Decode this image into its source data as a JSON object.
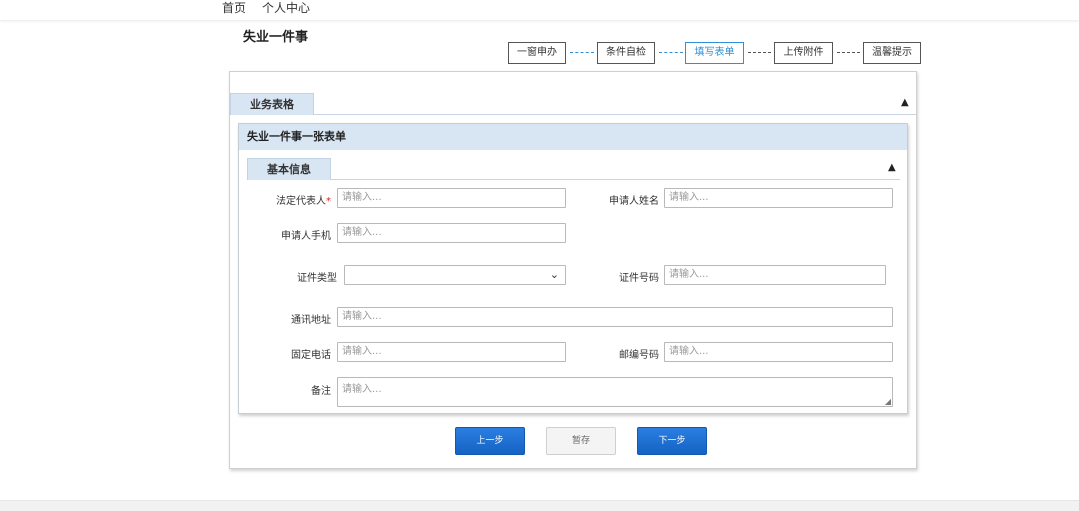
{
  "nav": {
    "home": "首页",
    "personal": "个人中心"
  },
  "page_title": "失业一件事",
  "steps": [
    "一窗申办",
    "条件自检",
    "填写表单",
    "上传附件",
    "温馨提示"
  ],
  "active_step": "填写表单",
  "outer_panel": {
    "tab": "业务表格"
  },
  "form_panel": {
    "title": "失业一件事一张表单",
    "section_tab": "基本信息",
    "fields": {
      "legal_rep": {
        "label": "法定代表人",
        "required_mark": "*",
        "placeholder": "请输入..."
      },
      "applicant_name": {
        "label": "申请人姓名",
        "placeholder": "请输入..."
      },
      "applicant_phone": {
        "label": "申请人手机",
        "placeholder": "请输入..."
      },
      "id_type": {
        "label": "证件类型",
        "value": ""
      },
      "id_number": {
        "label": "证件号码",
        "placeholder": "请输入..."
      },
      "address": {
        "label": "通讯地址",
        "placeholder": "请输入..."
      },
      "landline": {
        "label": "固定电话",
        "placeholder": "请输入..."
      },
      "postcode": {
        "label": "邮编号码",
        "placeholder": "请输入..."
      },
      "remarks": {
        "label": "备注",
        "placeholder": "请输入..."
      }
    }
  },
  "buttons": {
    "prev": "上一步",
    "save": "暂存",
    "next": "下一步"
  },
  "icons": {
    "collapse": "chevron-up-icon",
    "dropdown": "chevron-down-icon",
    "resize": "resize-grip-icon"
  },
  "colors": {
    "accent": "#1d6fd6",
    "active_step": "#2f8fd8",
    "header_bg": "#d8e6f4",
    "required": "#e02020"
  }
}
